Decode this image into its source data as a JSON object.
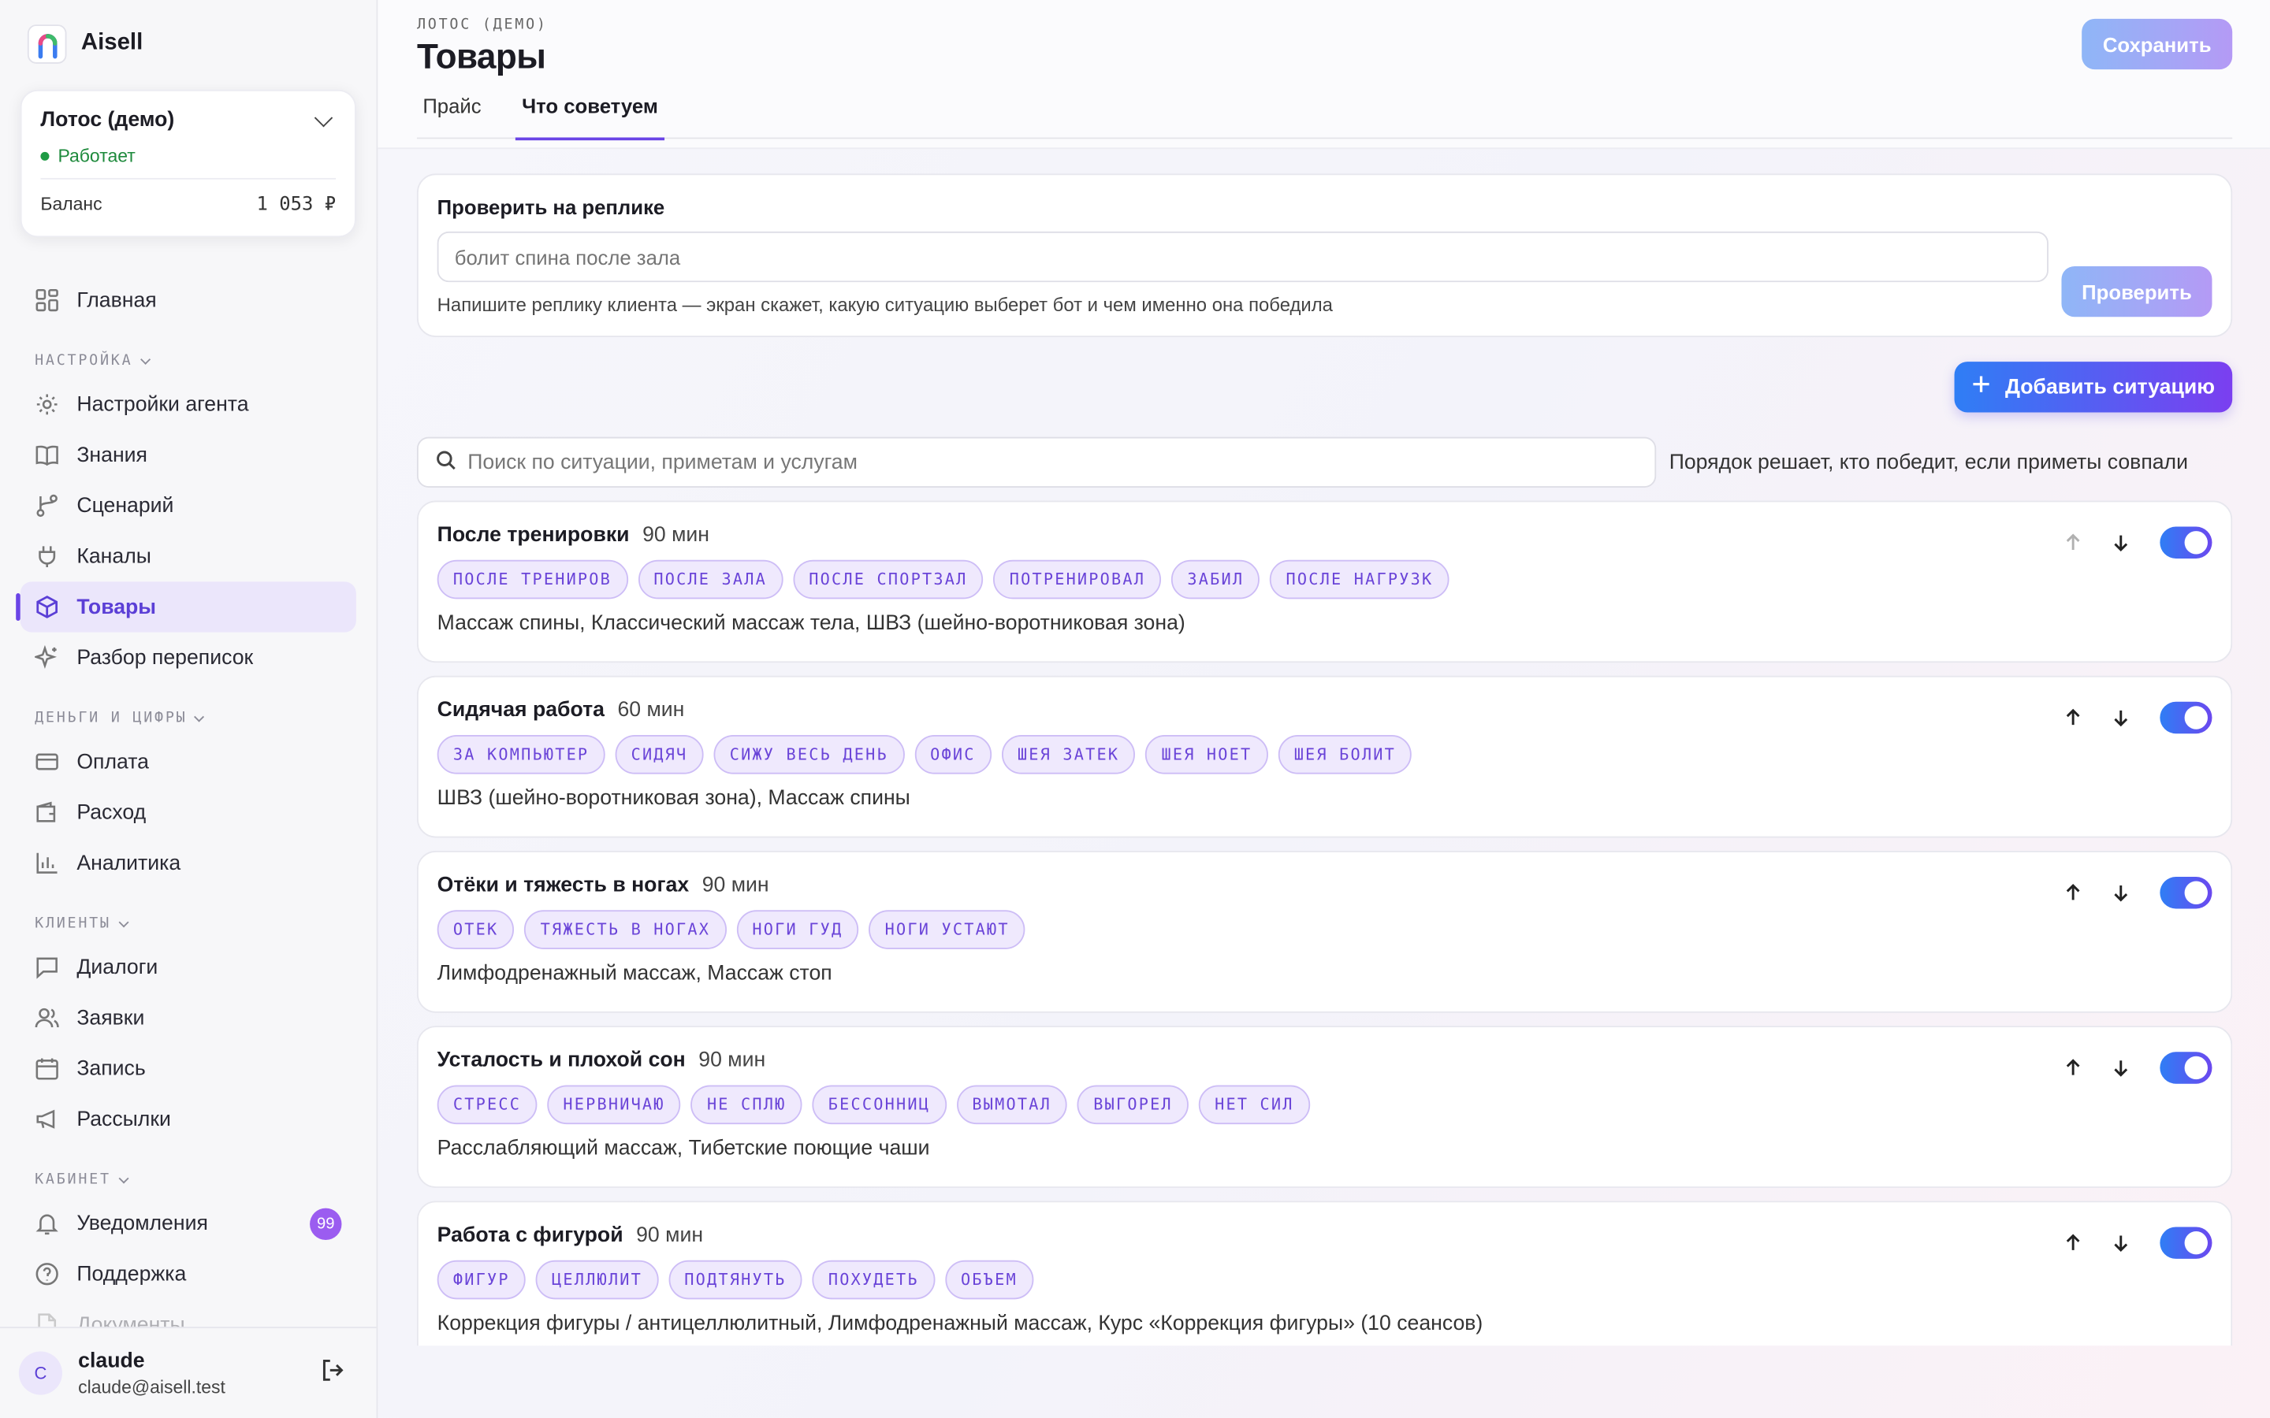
{
  "app": {
    "brand": "Aisell"
  },
  "org": {
    "name": "Лотос (демо)",
    "status": "Работает",
    "balance_label": "Баланс",
    "balance_value": "1 053 ₽"
  },
  "nav": {
    "home": "Главная",
    "section_settings": "НАСТРОЙКА",
    "agent_settings": "Настройки агента",
    "knowledge": "Знания",
    "scenario": "Сценарий",
    "channels": "Каналы",
    "products": "Товары",
    "chat_review": "Разбор переписок",
    "section_money": "ДЕНЬГИ И ЦИФРЫ",
    "payment": "Оплата",
    "expense": "Расход",
    "analytics": "Аналитика",
    "section_clients": "КЛИЕНТЫ",
    "dialogs": "Диалоги",
    "requests": "Заявки",
    "booking": "Запись",
    "mailings": "Рассылки",
    "section_cabinet": "КАБИНЕТ",
    "notifications": "Уведомления",
    "notifications_count": "99",
    "support": "Поддержка",
    "documents": "Документы"
  },
  "user": {
    "initial": "C",
    "name": "claude",
    "email": "claude@aisell.test"
  },
  "header": {
    "breadcrumb": "ЛОТОС (ДЕМО)",
    "title": "Товары",
    "save_label": "Сохранить"
  },
  "tabs": [
    {
      "label": "Прайс"
    },
    {
      "label": "Что советуем"
    }
  ],
  "check": {
    "title": "Проверить на реплике",
    "placeholder": "болит спина после зала",
    "hint": "Напишите реплику клиента — экран скажет, какую ситуацию выберет бот и чем именно она победила",
    "button": "Проверить"
  },
  "add_button": "Добавить ситуацию",
  "search": {
    "placeholder": "Поиск по ситуации, приметам и услугам",
    "order_hint": "Порядок решает, кто победит, если приметы совпали"
  },
  "situations": [
    {
      "name": "После тренировки",
      "duration": "90 мин",
      "tags": [
        "ПОСЛЕ ТРЕНИРОВ",
        "ПОСЛЕ ЗАЛА",
        "ПОСЛЕ СПОРТЗАЛ",
        "ПОТРЕНИРОВАЛ",
        "ЗАБИЛ",
        "ПОСЛЕ НАГРУЗК"
      ],
      "services": "Массаж спины, Классический массаж тела, ШВЗ (шейно-воротниковая зона)"
    },
    {
      "name": "Сидячая работа",
      "duration": "60 мин",
      "tags": [
        "ЗА КОМПЬЮТЕР",
        "СИДЯЧ",
        "СИЖУ ВЕСЬ ДЕНЬ",
        "ОФИС",
        "ШЕЯ ЗАТЕК",
        "ШЕЯ НОЕТ",
        "ШЕЯ БОЛИТ"
      ],
      "services": "ШВЗ (шейно-воротниковая зона), Массаж спины"
    },
    {
      "name": "Отёки и тяжесть в ногах",
      "duration": "90 мин",
      "tags": [
        "ОТЕК",
        "ТЯЖЕСТЬ В НОГАХ",
        "НОГИ ГУД",
        "НОГИ УСТАЮТ"
      ],
      "services": "Лимфодренажный массаж, Массаж стоп"
    },
    {
      "name": "Усталость и плохой сон",
      "duration": "90 мин",
      "tags": [
        "СТРЕСС",
        "НЕРВНИЧАЮ",
        "НЕ СПЛЮ",
        "БЕССОННИЦ",
        "ВЫМОТАЛ",
        "ВЫГОРЕЛ",
        "НЕТ СИЛ"
      ],
      "services": "Расслабляющий массаж, Тибетские поющие чаши"
    },
    {
      "name": "Работа с фигурой",
      "duration": "90 мин",
      "tags": [
        "ФИГУР",
        "ЦЕЛЛЮЛИТ",
        "ПОДТЯНУТЬ",
        "ПОХУДЕТЬ",
        "ОБЪЕМ"
      ],
      "services": "Коррекция фигуры / антицеллюлитный, Лимфодренажный массаж, Курс «Коррекция фигуры» (10 сеансов)"
    }
  ]
}
